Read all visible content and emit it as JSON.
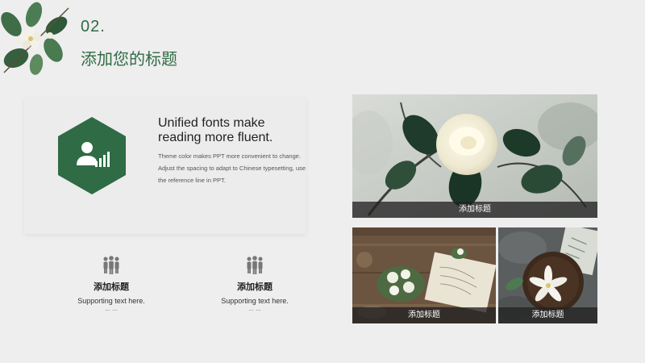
{
  "header": {
    "number": "02.",
    "title": "添加您的标题"
  },
  "card": {
    "heading": "Unified fonts make reading more fluent.",
    "body_line1": "Theme color makes PPT more convenient to change.",
    "body_line2": "Adjust the spacing to adapt to Chinese typesetting, use the reference line in PPT."
  },
  "features": [
    {
      "title": "添加标题",
      "text": "Supporting text here.",
      "dots": "... ..."
    },
    {
      "title": "添加标题",
      "text": "Supporting text here.",
      "dots": "... ..."
    }
  ],
  "photos": [
    {
      "caption": "添加标题"
    },
    {
      "caption": "添加标题"
    },
    {
      "caption": "添加标题"
    }
  ],
  "colors": {
    "accent": "#2f6b45",
    "background": "#eeeeee",
    "caption_bar": "#232323"
  },
  "icons": {
    "hexagon": "user-chart-icon",
    "feature": "group-people-icon",
    "decoration": "floral-decoration-icon"
  }
}
